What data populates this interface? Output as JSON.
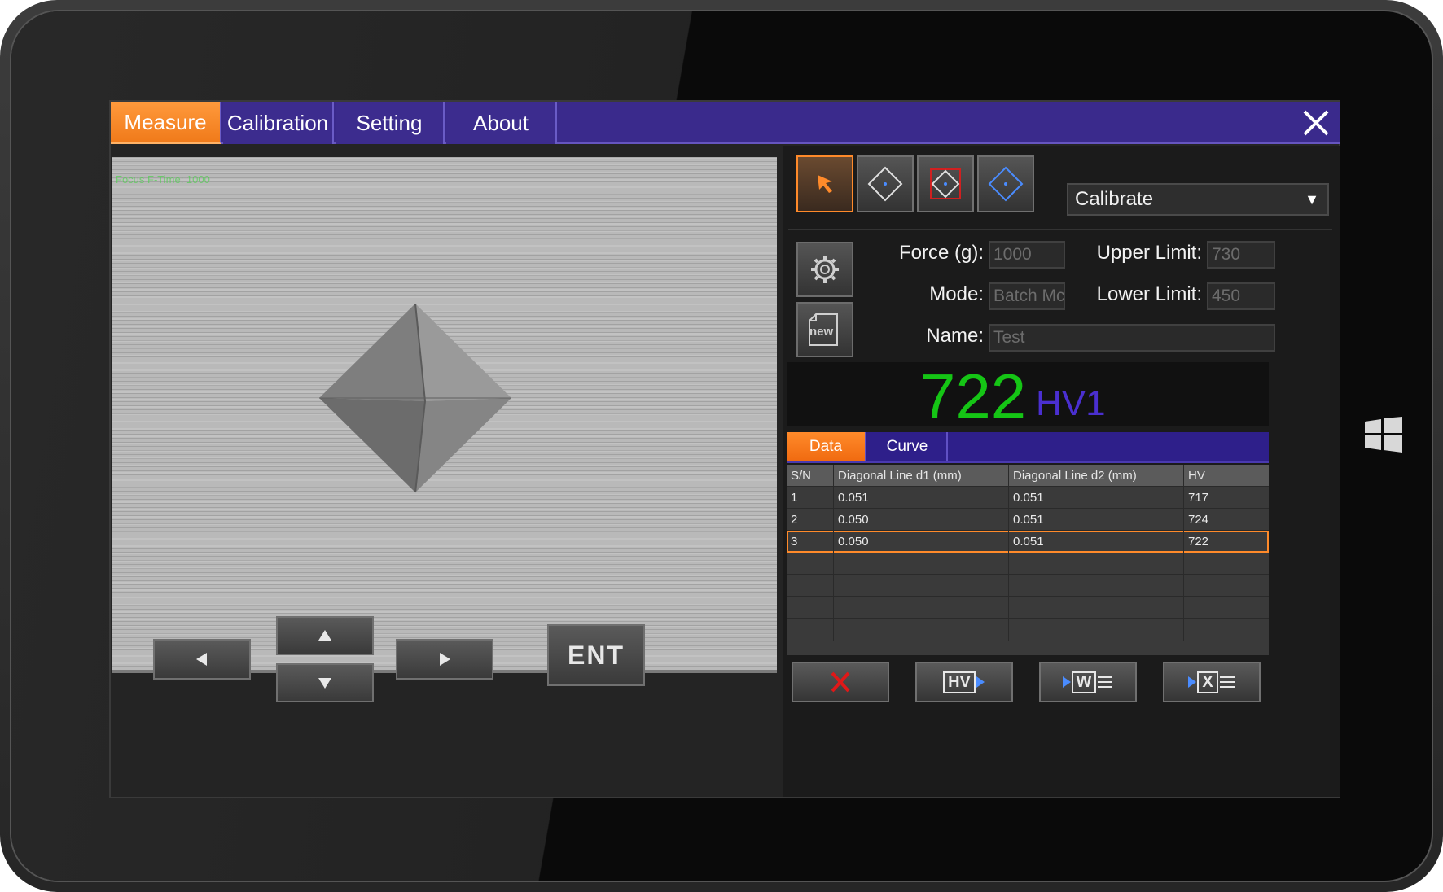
{
  "tabs": [
    {
      "label": "Measure",
      "active": true
    },
    {
      "label": "Calibration",
      "active": false
    },
    {
      "label": "Setting",
      "active": false
    },
    {
      "label": "About",
      "active": false
    }
  ],
  "camera": {
    "overlay_text": "Focus F-Time: 1000"
  },
  "controls": {
    "ent_label": "ENT"
  },
  "tools": {
    "mode_dropdown": "Calibrate"
  },
  "form": {
    "force_label": "Force (g):",
    "force_value": "1000",
    "upper_label": "Upper Limit:",
    "upper_value": "730",
    "mode_label": "Mode:",
    "mode_value": "Batch Mc",
    "lower_label": "Lower Limit:",
    "lower_value": "450",
    "name_label": "Name:",
    "name_value": "Test",
    "new_button_label": "new"
  },
  "result": {
    "value": "722",
    "unit": "HV1"
  },
  "subtabs": [
    {
      "label": "Data",
      "active": true
    },
    {
      "label": "Curve",
      "active": false
    }
  ],
  "table": {
    "headers": [
      "S/N",
      "Diagonal Line d1 (mm)",
      "Diagonal Line d2 (mm)",
      "HV"
    ],
    "rows": [
      [
        "1",
        "0.051",
        "0.051",
        "717"
      ],
      [
        "2",
        "0.050",
        "0.051",
        "724"
      ],
      [
        "3",
        "0.050",
        "0.051",
        "722"
      ]
    ],
    "selected_row": 3
  },
  "actions": {
    "hv_label": "HV",
    "word_label": "W",
    "excel_label": "X"
  },
  "colors": {
    "accent": "#f07a1a",
    "nav": "#3a2a8c",
    "result_value": "#15c515",
    "result_unit": "#4a2fd0"
  }
}
